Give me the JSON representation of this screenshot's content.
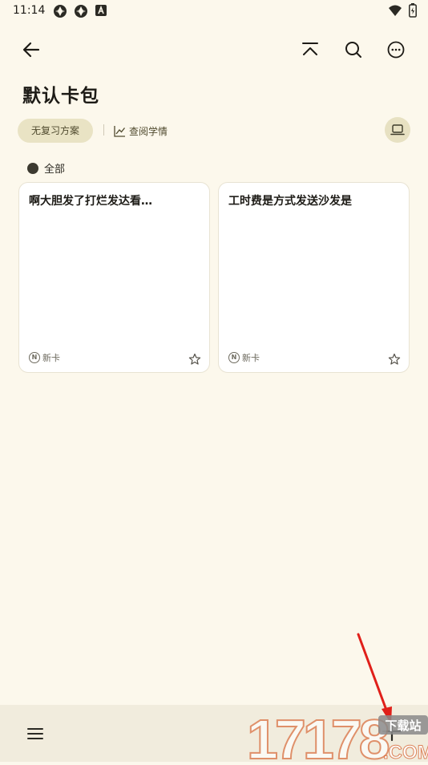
{
  "status": {
    "time": "11:14",
    "left_icons": [
      "sync-icon",
      "sync-icon",
      "a-icon"
    ],
    "right_icons": [
      "wifi-icon",
      "battery-icon"
    ]
  },
  "app_bar": {
    "back_icon": "arrow-left-icon",
    "actions": [
      "scroll-to-top-icon",
      "search-icon",
      "more-icon"
    ]
  },
  "page": {
    "title": "默认卡包",
    "review_chip": "无复习方案",
    "stats_chip": "查阅学情",
    "mode_icon": "laptop-icon"
  },
  "filter": {
    "label": "全部"
  },
  "cards": [
    {
      "title": "啊大胆发了打烂发达看…",
      "tag": "新卡",
      "badge": "N"
    },
    {
      "title": "工时费是方式发送沙发是",
      "tag": "新卡",
      "badge": "N"
    }
  ],
  "bottom_bar": {
    "menu_icon": "menu-icon",
    "add_icon": "plus-icon"
  },
  "overlay": {
    "watermark_number": "17178",
    "watermark_top": "下载站",
    "watermark_bottom": ".COM"
  },
  "colors": {
    "background": "#fcf8ec",
    "chip": "#e9e3c4",
    "bottom_bar": "#f1ecdd",
    "arrow": "#e0201a",
    "watermark": "#d86a3a"
  }
}
